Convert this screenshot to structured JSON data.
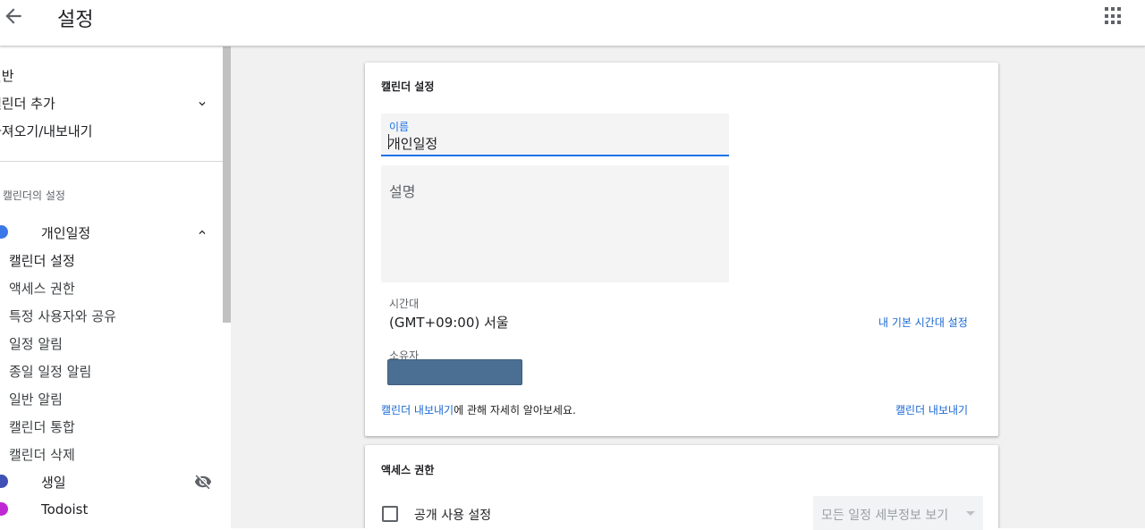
{
  "header": {
    "title": "설정"
  },
  "sidebar": {
    "items": [
      {
        "label": "일반"
      },
      {
        "label": "캘린더 추가"
      },
      {
        "label": "가져오기/내보내기"
      }
    ],
    "section_label": "내 캘린더의 설정",
    "calendars": [
      {
        "name": "개인일정",
        "color": "#3b78e7"
      },
      {
        "name": "생일",
        "color": "#3f51b5"
      },
      {
        "name": "Todoist",
        "color": "#c026d3"
      }
    ],
    "sub_items": [
      {
        "label": "캘린더 설정"
      },
      {
        "label": "액세스 권한"
      },
      {
        "label": "특정 사용자와 공유"
      },
      {
        "label": "일정 알림"
      },
      {
        "label": "종일 일정 알림"
      },
      {
        "label": "일반 알림"
      },
      {
        "label": "캘린더 통합"
      },
      {
        "label": "캘린더 삭제"
      }
    ]
  },
  "calendar_settings": {
    "title": "캘린더 설정",
    "name_label": "이름",
    "name_value": "개인일정",
    "description_placeholder": "설명",
    "timezone_label": "시간대",
    "timezone_value": "(GMT+09:00) 서울",
    "timezone_link": "내 기본 시간대 설정",
    "owner_label": "소유자",
    "export_link": "캘린더 내보내기",
    "export_text": "에 관해 자세히 알아보세요.",
    "export_button": "캘린더 내보내기"
  },
  "access": {
    "title": "액세스 권한",
    "public_label": "공개 사용 설정",
    "select_value": "모든 일정 세부정보 보기"
  },
  "colors": {
    "accent": "#1a73e8",
    "link": "#1967d2"
  }
}
